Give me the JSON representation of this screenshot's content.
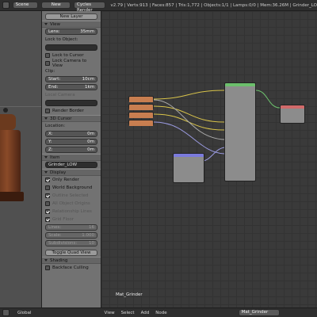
{
  "topbar": {
    "scene": "Scene",
    "new_label": "New",
    "renderer": "Cycles Render",
    "stats": "v2.79 | Verts:913 | Faces:857 | Tris:1,772 | Objects:1/1 | Lamps:0/0 | Mem:36.26M | Grinder_LO"
  },
  "sidebar": {
    "new_layer": "New Layer",
    "view": {
      "title": "View",
      "lens_label": "Lens:",
      "lens_value": "35mm",
      "lock_to_object": "Lock to Object:",
      "lock_to_cursor": "Lock to Cursor",
      "lock_camera": "Lock Camera to View",
      "clip": "Clip:",
      "start_label": "Start:",
      "start_value": "10cm",
      "end_label": "End:",
      "end_value": "1km",
      "local_camera": "Local Camera",
      "render_border": "Render Border"
    },
    "cursor": {
      "title": "3D Cursor",
      "location": "Location:",
      "x_label": "X:",
      "x_value": "0m",
      "y_label": "Y:",
      "y_value": "0m",
      "z_label": "Z:",
      "z_value": "0m"
    },
    "item": {
      "title": "Item",
      "name": "Grinder_LOW"
    },
    "display": {
      "title": "Display",
      "only_render": "Only Render",
      "world_background": "World Background",
      "outline_selected": "Outline Selected",
      "all_object_origins": "All Object Origins",
      "relationship_lines": "Relationship Lines",
      "grid_floor": "Grid Floor",
      "lines_label": "Lines:",
      "lines_value": "16",
      "scale_label": "Scale:",
      "scale_value": "1.000",
      "subdiv_label": "Subdivisions:",
      "subdiv_value": "10",
      "toggle_quad": "Toggle Quad View"
    },
    "shading": {
      "title": "Shading",
      "backface": "Backface Culling"
    }
  },
  "node_editor": {
    "material_name": "Mat_Grinder"
  },
  "bottombar": {
    "view": "View",
    "select": "Select",
    "add": "Add",
    "node": "Node",
    "global": "Global",
    "material": "Mat_Grinder"
  },
  "colors": {
    "node_image": "#c87e50",
    "node_bsdf": "#6cbf6c",
    "node_output": "#d16a6a",
    "node_mapping": "#7a7adc",
    "link_yellow": "#d8c34a",
    "link_purple": "#9a9ae0",
    "link_grey": "#aaaaaa"
  }
}
